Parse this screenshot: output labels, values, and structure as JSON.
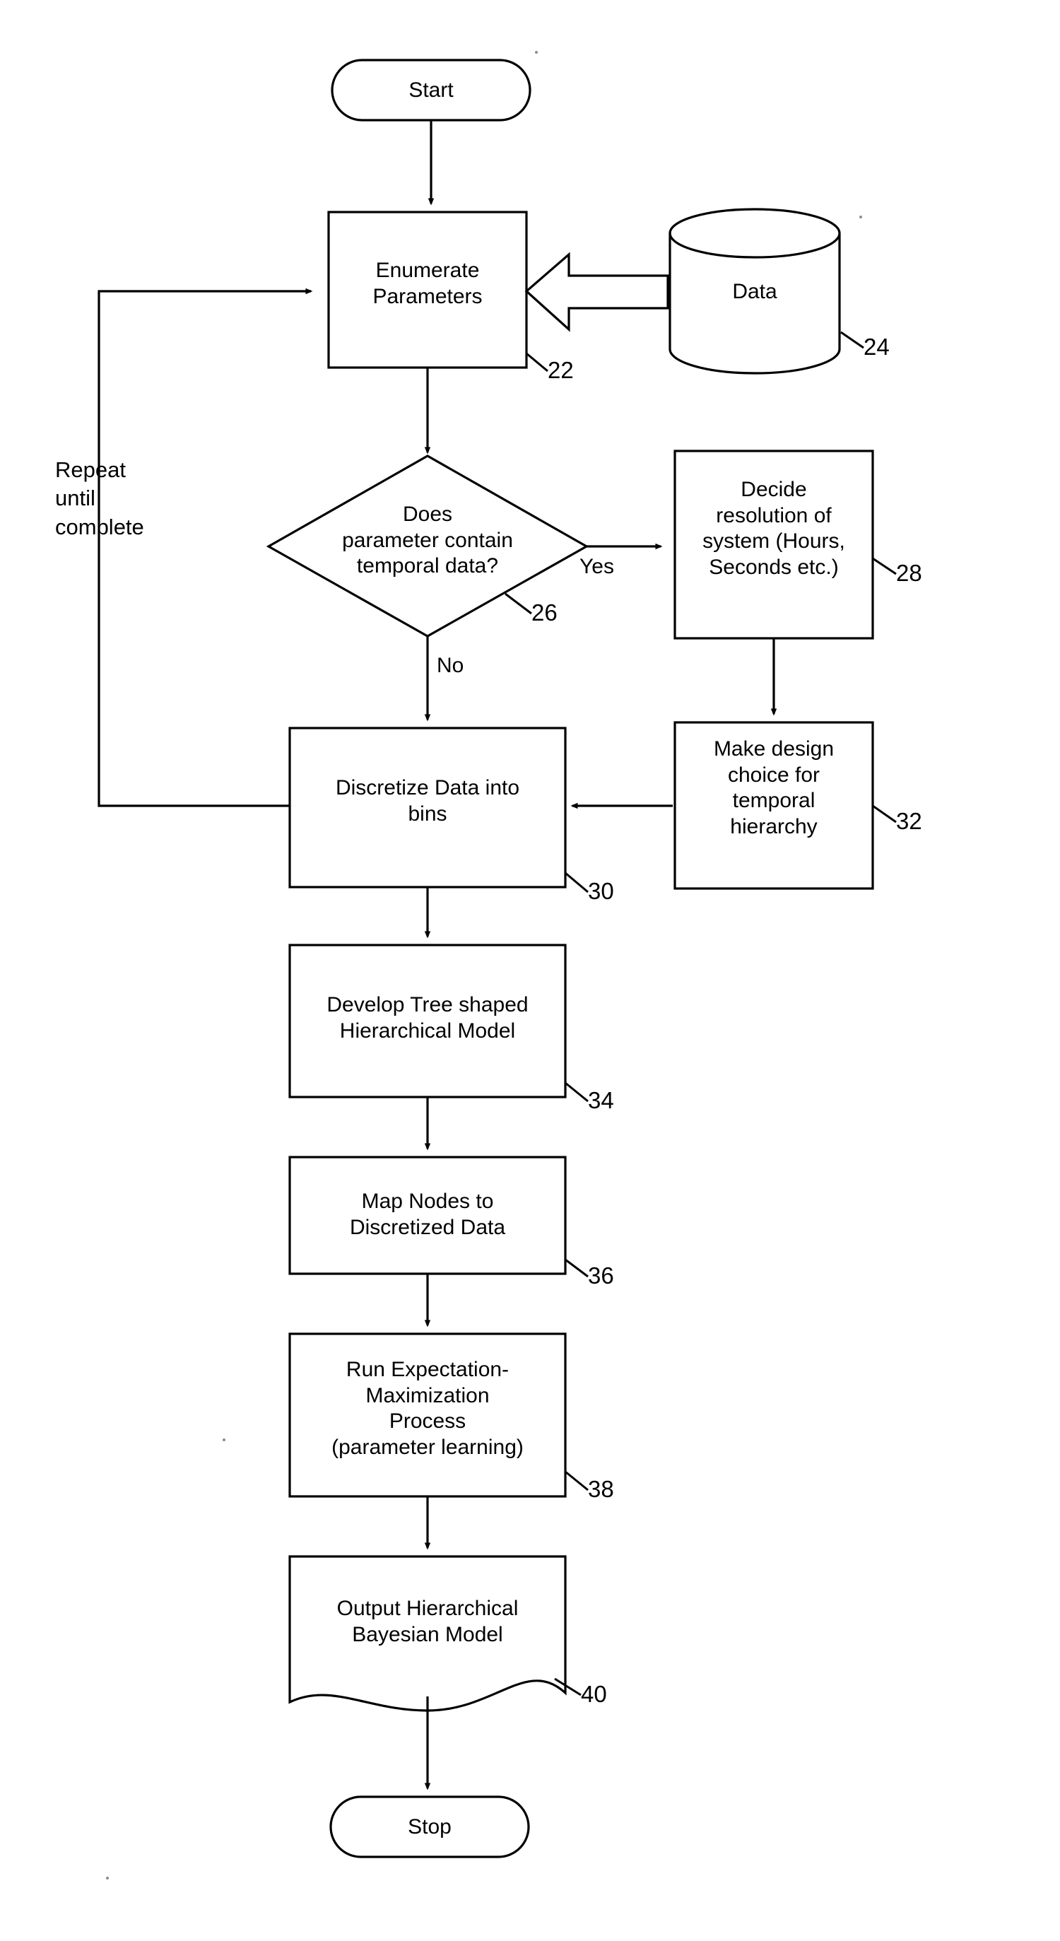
{
  "diagram": {
    "type": "flowchart",
    "title_visible": false,
    "nodes": [
      {
        "id": "start",
        "shape": "stadium",
        "label": "Start"
      },
      {
        "id": "enumerate",
        "shape": "rect",
        "label": "Enumerate\nParameters",
        "ref": "22"
      },
      {
        "id": "data",
        "shape": "cylinder",
        "label": "Data",
        "ref": "24"
      },
      {
        "id": "decision",
        "shape": "diamond",
        "label": "Does\nparameter contain\ntemporal data?",
        "ref": "26"
      },
      {
        "id": "resolution",
        "shape": "rect",
        "label": "Decide\nresolution of\nsystem (Hours,\nSeconds etc.)",
        "ref": "28"
      },
      {
        "id": "design",
        "shape": "rect",
        "label": "Make design\nchoice for\ntemporal\nhierarchy",
        "ref": "32"
      },
      {
        "id": "discretize",
        "shape": "rect",
        "label": "Discretize Data into\nbins",
        "ref": "30"
      },
      {
        "id": "tree",
        "shape": "rect",
        "label": "Develop Tree shaped\nHierarchical Model",
        "ref": "34"
      },
      {
        "id": "mapnodes",
        "shape": "rect",
        "label": "Map Nodes to\nDiscretized Data",
        "ref": "36"
      },
      {
        "id": "em",
        "shape": "rect",
        "label": "Run Expectation-\nMaximization\nProcess\n(parameter learning)",
        "ref": "38"
      },
      {
        "id": "output",
        "shape": "document",
        "label": "Output Hierarchical\nBayesian Model",
        "ref": "40"
      },
      {
        "id": "stop",
        "shape": "stadium",
        "label": "Stop"
      }
    ],
    "edge_labels": [
      {
        "id": "yes-label",
        "text": "Yes"
      },
      {
        "id": "no-label",
        "text": "No"
      }
    ],
    "annotations": [
      {
        "id": "repeat-note",
        "text": "Repeat\nuntil\ncomplete"
      }
    ],
    "reference_numbers": [
      "22",
      "24",
      "26",
      "28",
      "30",
      "32",
      "34",
      "36",
      "38",
      "40"
    ],
    "colors": {
      "stroke": "#000000",
      "fill": "#ffffff",
      "text": "#000000"
    }
  }
}
